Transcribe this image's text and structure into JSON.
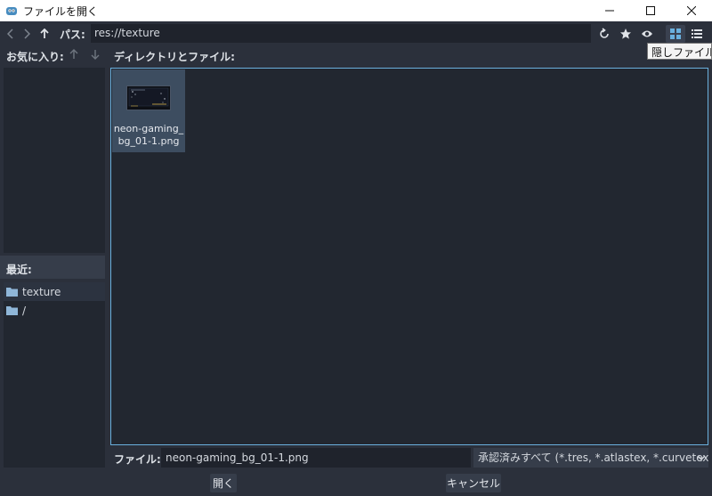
{
  "window": {
    "title": "ファイルを開く",
    "minimize": "—",
    "maximize": "☐",
    "close": "✕"
  },
  "toolbar": {
    "path_label": "パス:",
    "path_value": "res://texture",
    "tooltip": "隠しファイルの"
  },
  "favorites": {
    "label": "お気に入り:"
  },
  "recent": {
    "label": "最近:",
    "items": [
      {
        "name": "texture",
        "icon": "folder-icon"
      },
      {
        "name": "/",
        "icon": "folder-icon"
      }
    ]
  },
  "main": {
    "label": "ディレクトリとファイル:",
    "files": [
      {
        "name": "neon-gaming_bg_01-1.png",
        "line1": "neon-gaming_",
        "line2": "bg_01-1.png"
      }
    ]
  },
  "footer": {
    "file_label": "ファイル:",
    "file_value": "neon-gaming_bg_01-1.png",
    "filter": "承認済みすべて (*.tres, *.atlastex, *.curvetex, *.meshtex",
    "open_button": "開く",
    "cancel_button": "キャンセル"
  },
  "colors": {
    "background": "#2b303b",
    "panel": "#222730",
    "accent": "#6ab0de",
    "selected_tile": "#3d4d60",
    "folder": "#8fb6d8"
  }
}
